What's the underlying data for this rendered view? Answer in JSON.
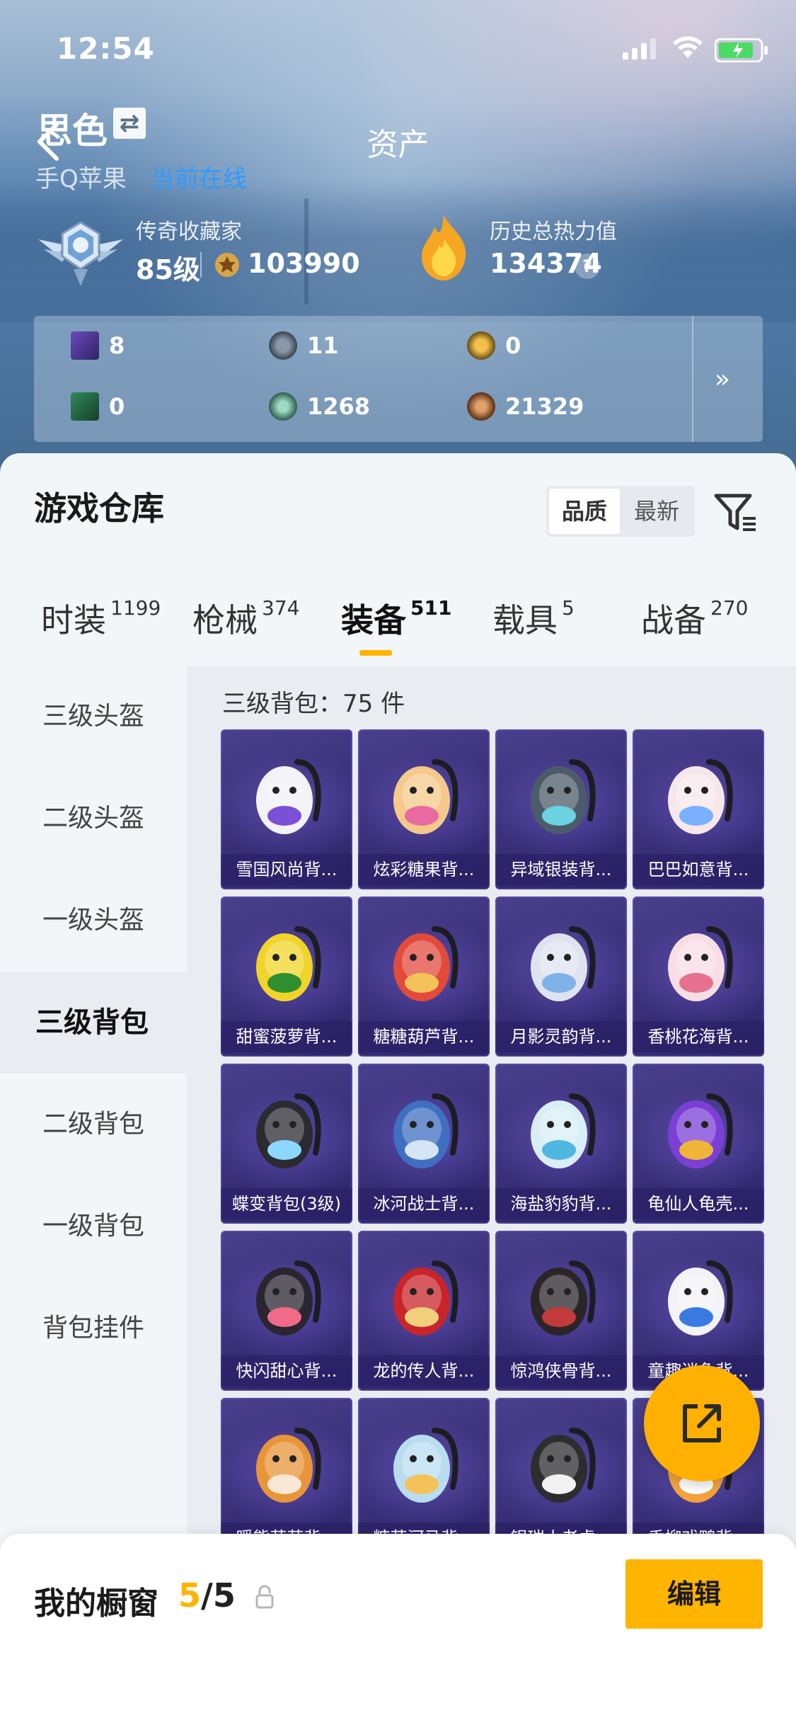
{
  "status_bar": {
    "time": "12:54"
  },
  "nav": {
    "title": "资产"
  },
  "user": {
    "name": "思色",
    "platform": "手Q苹果",
    "online_status": "当前在线"
  },
  "stats": {
    "collector_label": "传奇收藏家",
    "level": "85级",
    "medal_points": "103990",
    "heat_label": "历史总热力值",
    "heat_value": "134374",
    "help": "?"
  },
  "currencies": [
    {
      "icon": "purple-card-icon",
      "value": "8"
    },
    {
      "icon": "silver-coin-icon",
      "value": "11"
    },
    {
      "icon": "gold-coin-icon",
      "value": "0"
    },
    {
      "icon": "green-card-icon",
      "value": "0"
    },
    {
      "icon": "green-orb-icon",
      "value": "1268"
    },
    {
      "icon": "bronze-coin-icon",
      "value": "21329"
    }
  ],
  "more": "»",
  "warehouse": {
    "title": "游戏仓库",
    "sort": {
      "quality": "品质",
      "newest": "最新"
    }
  },
  "tabs": [
    {
      "label": "时装",
      "count": "1199"
    },
    {
      "label": "枪械",
      "count": "374"
    },
    {
      "label": "装备",
      "count": "511"
    },
    {
      "label": "载具",
      "count": "5"
    },
    {
      "label": "战备",
      "count": "270"
    }
  ],
  "sidebar": [
    {
      "label": "三级头盔"
    },
    {
      "label": "二级头盔"
    },
    {
      "label": "一级头盔"
    },
    {
      "label": "三级背包"
    },
    {
      "label": "二级背包"
    },
    {
      "label": "一级背包"
    },
    {
      "label": "背包挂件"
    }
  ],
  "category_header": "三级背包：75 件",
  "items": [
    {
      "name": "雪国风尚背...",
      "color": "#f2f2f7",
      "accent": "#7b4fd6"
    },
    {
      "name": "炫彩糖果背...",
      "color": "#f5c98a",
      "accent": "#e86aa0"
    },
    {
      "name": "异域银装背...",
      "color": "#4c5b6a",
      "accent": "#6ad2e0"
    },
    {
      "name": "巴巴如意背...",
      "color": "#f6e7ea",
      "accent": "#7ab0ff"
    },
    {
      "name": "甜蜜菠萝背...",
      "color": "#f0d42a",
      "accent": "#2f8f2f"
    },
    {
      "name": "糖糖葫芦背...",
      "color": "#e24a3c",
      "accent": "#f3c35a"
    },
    {
      "name": "月影灵韵背...",
      "color": "#dfe3ef",
      "accent": "#7fb2e8"
    },
    {
      "name": "香桃花海背...",
      "color": "#f7dde4",
      "accent": "#e6708d"
    },
    {
      "name": "蝶变背包(3级)",
      "color": "#2a2a30",
      "accent": "#8ad8ff"
    },
    {
      "name": "冰河战士背...",
      "color": "#3f6fc0",
      "accent": "#d7e4f5"
    },
    {
      "name": "海盐豹豹背...",
      "color": "#d9eef7",
      "accent": "#4fb7e0"
    },
    {
      "name": "龟仙人龟壳...",
      "color": "#7b3fd6",
      "accent": "#f0b43a"
    },
    {
      "name": "快闪甜心背...",
      "color": "#2a2530",
      "accent": "#f06a8a"
    },
    {
      "name": "龙的传人背...",
      "color": "#c8252a",
      "accent": "#f2d07a"
    },
    {
      "name": "惊鸿侠骨背...",
      "color": "#2b2528",
      "accent": "#c23a3a"
    },
    {
      "name": "童趣迷兔背...",
      "color": "#f3f3f7",
      "accent": "#3a7ae0"
    },
    {
      "name": "暖熊萌萌背...",
      "color": "#e8953a",
      "accent": "#f7e7d4"
    },
    {
      "name": "糖萌河马背...",
      "color": "#b9dcef",
      "accent": "#f3c35a"
    },
    {
      "name": "银瑞小老虎...",
      "color": "#2d2d30",
      "accent": "#f2f2f2"
    },
    {
      "name": "香柳戏鸭背...",
      "color": "#f3a23a",
      "accent": "#fff"
    }
  ],
  "showcase": {
    "label": "我的橱窗",
    "current": "5",
    "total": "/5",
    "edit": "编辑"
  },
  "colors": {
    "accent": "#ffb400",
    "card_bg": "#3a2f78",
    "online": "#2f9bff"
  }
}
